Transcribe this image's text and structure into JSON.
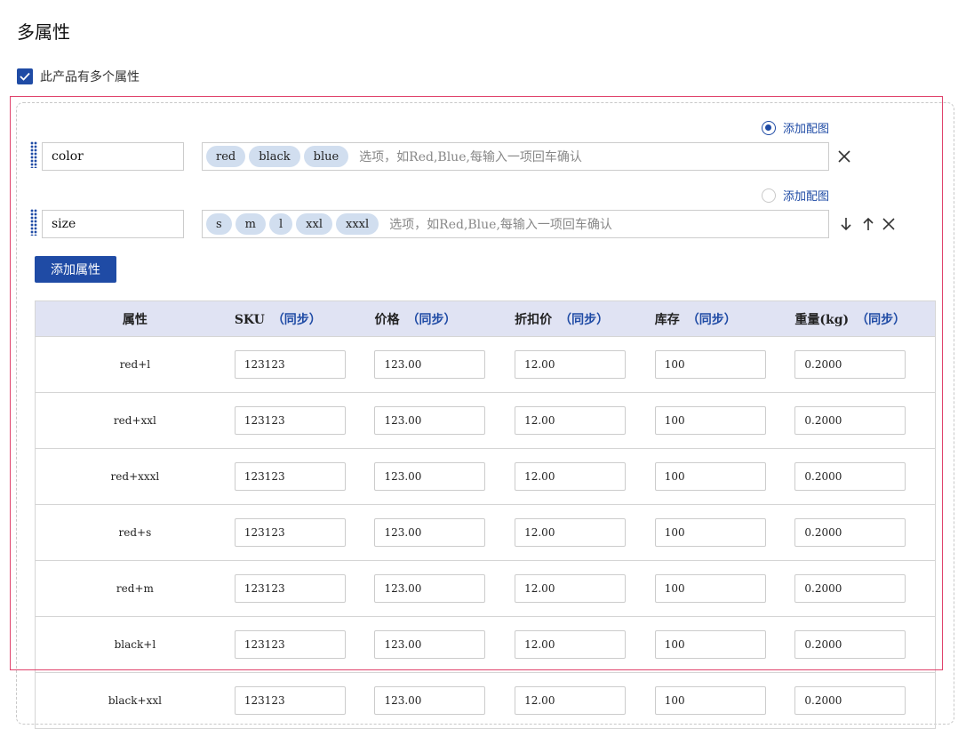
{
  "page_title": "多属性",
  "multi_attr_checkbox": {
    "label": "此产品有多个属性",
    "checked": true
  },
  "attributes": [
    {
      "name": "color",
      "tags": [
        "red",
        "black",
        "blue"
      ],
      "placeholder": "选项，如Red,Blue,每输入一项回车确认",
      "image_toggle": {
        "label": "添加配图",
        "checked": true
      }
    },
    {
      "name": "size",
      "tags": [
        "s",
        "m",
        "l",
        "xxl",
        "xxxl"
      ],
      "placeholder": "选项，如Red,Blue,每输入一项回车确认",
      "image_toggle": {
        "label": "添加配图",
        "checked": false
      }
    }
  ],
  "add_attribute_button": "添加属性",
  "table": {
    "headers": [
      {
        "label": "属性",
        "sync": ""
      },
      {
        "label": "SKU",
        "sync": "（同步）"
      },
      {
        "label": "价格",
        "sync": "（同步）"
      },
      {
        "label": "折扣价",
        "sync": "（同步）"
      },
      {
        "label": "库存",
        "sync": "（同步）"
      },
      {
        "label": "重量(kg)",
        "sync": "（同步）"
      }
    ],
    "rows": [
      {
        "attr": "red+l",
        "sku": "123123",
        "price": "123.00",
        "discount": "12.00",
        "stock": "100",
        "weight": "0.2000"
      },
      {
        "attr": "red+xxl",
        "sku": "123123",
        "price": "123.00",
        "discount": "12.00",
        "stock": "100",
        "weight": "0.2000"
      },
      {
        "attr": "red+xxxl",
        "sku": "123123",
        "price": "123.00",
        "discount": "12.00",
        "stock": "100",
        "weight": "0.2000"
      },
      {
        "attr": "red+s",
        "sku": "123123",
        "price": "123.00",
        "discount": "12.00",
        "stock": "100",
        "weight": "0.2000"
      },
      {
        "attr": "red+m",
        "sku": "123123",
        "price": "123.00",
        "discount": "12.00",
        "stock": "100",
        "weight": "0.2000"
      },
      {
        "attr": "black+l",
        "sku": "123123",
        "price": "123.00",
        "discount": "12.00",
        "stock": "100",
        "weight": "0.2000"
      },
      {
        "attr": "black+xxl",
        "sku": "123123",
        "price": "123.00",
        "discount": "12.00",
        "stock": "100",
        "weight": "0.2000"
      }
    ]
  },
  "colors": {
    "primary": "#1f4ba5",
    "table_header_bg": "#e0e3f3",
    "tag_bg": "#d1deef",
    "highlight_frame": "#e0426b"
  },
  "icons": {
    "close": "close-icon",
    "up": "arrow-up-icon",
    "down": "arrow-down-icon",
    "drag": "drag-handle-icon",
    "check": "check-icon"
  }
}
